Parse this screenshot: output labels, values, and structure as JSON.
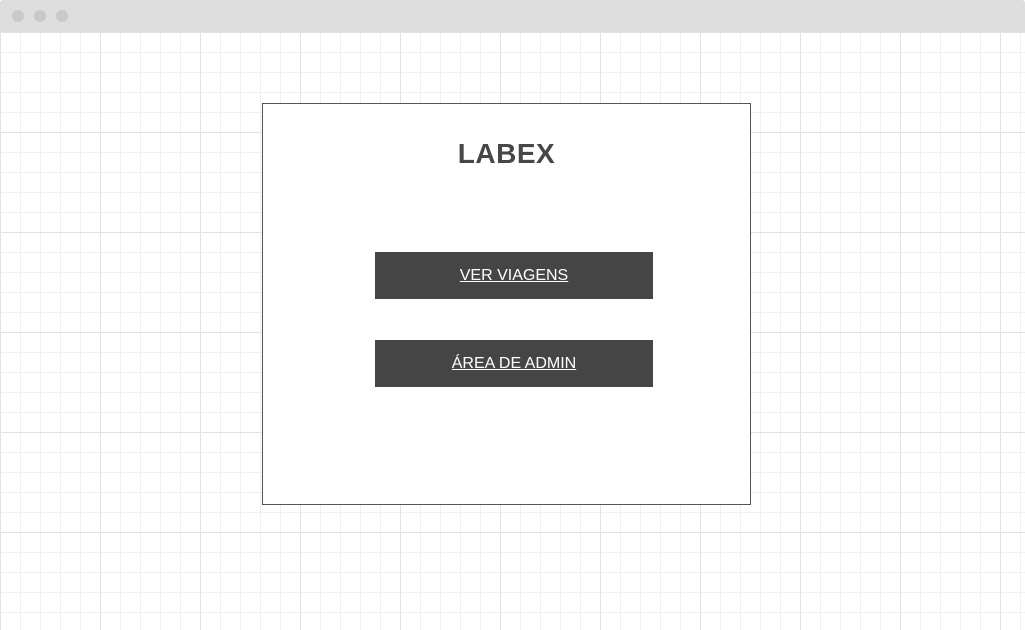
{
  "window": {
    "controls": [
      "close-dot",
      "minimize-dot",
      "maximize-dot"
    ]
  },
  "app": {
    "title": "LABEX"
  },
  "actions": {
    "trips_label": "VER VIAGENS",
    "admin_label": "ÁREA DE ADMIN"
  },
  "colors": {
    "titlebar": "#dedede",
    "button_bg": "#454545",
    "button_text": "#ffffff",
    "title_text": "#474747",
    "panel_border": "#555555"
  }
}
